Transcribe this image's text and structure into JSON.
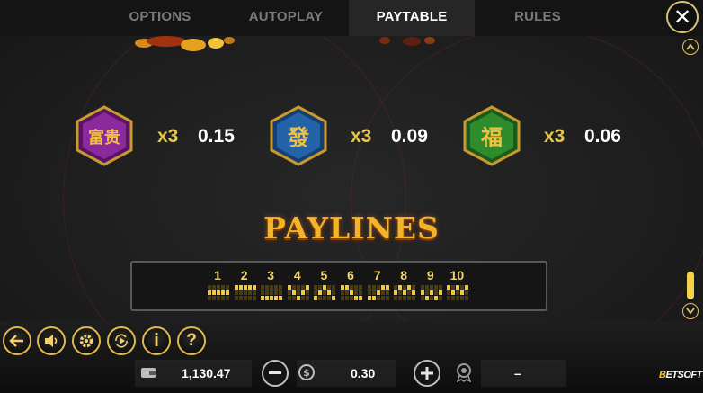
{
  "tabs": [
    {
      "label": "OPTIONS"
    },
    {
      "label": "AUTOPLAY"
    },
    {
      "label": "PAYTABLE"
    },
    {
      "label": "RULES"
    }
  ],
  "symbols": [
    {
      "name": "purple-tile",
      "multiplier": "x3",
      "value": "0.15",
      "glyph": "富贵",
      "color": "#8a2a9c"
    },
    {
      "name": "blue-tile",
      "multiplier": "x3",
      "value": "0.09",
      "glyph": "發",
      "color": "#2463a8"
    },
    {
      "name": "green-tile",
      "multiplier": "x3",
      "value": "0.06",
      "glyph": "福",
      "color": "#2f8c2c"
    }
  ],
  "paylines_title": "PAYLINES",
  "paylines": [
    {
      "n": "1",
      "pattern": [
        [
          0,
          0,
          0,
          0,
          0
        ],
        [
          1,
          1,
          1,
          1,
          1
        ],
        [
          0,
          0,
          0,
          0,
          0
        ]
      ]
    },
    {
      "n": "2",
      "pattern": [
        [
          1,
          1,
          1,
          1,
          1
        ],
        [
          0,
          0,
          0,
          0,
          0
        ],
        [
          0,
          0,
          0,
          0,
          0
        ]
      ]
    },
    {
      "n": "3",
      "pattern": [
        [
          0,
          0,
          0,
          0,
          0
        ],
        [
          0,
          0,
          0,
          0,
          0
        ],
        [
          1,
          1,
          1,
          1,
          1
        ]
      ]
    },
    {
      "n": "4",
      "pattern": [
        [
          1,
          0,
          0,
          0,
          1
        ],
        [
          0,
          1,
          0,
          1,
          0
        ],
        [
          0,
          0,
          1,
          0,
          0
        ]
      ]
    },
    {
      "n": "5",
      "pattern": [
        [
          0,
          0,
          1,
          0,
          0
        ],
        [
          0,
          1,
          0,
          1,
          0
        ],
        [
          1,
          0,
          0,
          0,
          1
        ]
      ]
    },
    {
      "n": "6",
      "pattern": [
        [
          1,
          1,
          0,
          0,
          0
        ],
        [
          0,
          0,
          1,
          0,
          0
        ],
        [
          0,
          0,
          0,
          1,
          1
        ]
      ]
    },
    {
      "n": "7",
      "pattern": [
        [
          0,
          0,
          0,
          1,
          1
        ],
        [
          0,
          0,
          1,
          0,
          0
        ],
        [
          1,
          1,
          0,
          0,
          0
        ]
      ]
    },
    {
      "n": "8",
      "pattern": [
        [
          0,
          1,
          0,
          1,
          0
        ],
        [
          1,
          0,
          1,
          0,
          1
        ],
        [
          0,
          0,
          0,
          0,
          0
        ]
      ]
    },
    {
      "n": "9",
      "pattern": [
        [
          0,
          0,
          0,
          0,
          0
        ],
        [
          1,
          0,
          1,
          0,
          1
        ],
        [
          0,
          1,
          0,
          1,
          0
        ]
      ]
    },
    {
      "n": "10",
      "pattern": [
        [
          1,
          0,
          1,
          0,
          1
        ],
        [
          0,
          1,
          0,
          1,
          0
        ],
        [
          0,
          0,
          0,
          0,
          0
        ]
      ]
    }
  ],
  "bottom": {
    "balance": "1,130.47",
    "bet": "0.30",
    "win": "–",
    "brand_b": "B",
    "brand_rest": "ETSOFT"
  },
  "colors": {
    "accent": "#e8c64a",
    "title": "#f2b52a"
  }
}
